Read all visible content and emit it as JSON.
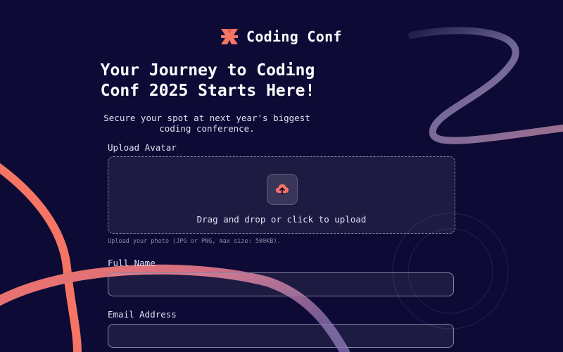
{
  "header": {
    "brand": "Coding Conf"
  },
  "hero": {
    "title": "Your Journey to Coding Conf 2025 Starts Here!",
    "subtitle": "Secure your spot at next year's biggest coding conference."
  },
  "form": {
    "avatar": {
      "label": "Upload Avatar",
      "dropzone_text": "Drag and drop or click to upload",
      "hint": "Upload your photo (JPG or PNG, max size: 500KB)."
    },
    "full_name": {
      "label": "Full Name",
      "value": "",
      "placeholder": ""
    },
    "email": {
      "label": "Email Address",
      "value": "",
      "placeholder": ""
    }
  },
  "colors": {
    "background": "#0d0a35",
    "accent": "#f57463",
    "accent_dark": "#e05d4f",
    "muted_text": "#8a87a6",
    "border": "#8784a5"
  },
  "icons": [
    "conference-logo-icon",
    "upload-cloud-icon"
  ]
}
